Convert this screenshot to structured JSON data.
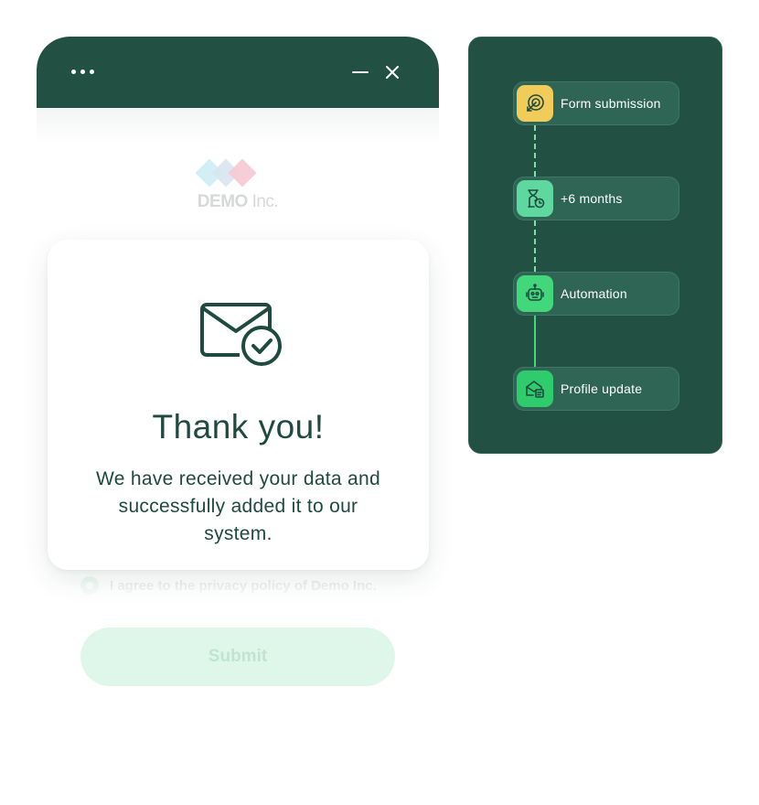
{
  "widget": {
    "logo": {
      "brand": "DEMO",
      "suffix": "Inc."
    },
    "consent_label": "I agree to the privacy policy of Demo Inc.",
    "submit_label": "Submit"
  },
  "card": {
    "title": "Thank you!",
    "message": "We have received your data and successfully added it to our system."
  },
  "workflow": {
    "steps": [
      {
        "label": "Form submission",
        "icon": "form-submission-icon",
        "color": "#f2cc5a"
      },
      {
        "label": "+6 months",
        "icon": "hourglass-timer-icon",
        "color": "#5fd8a0"
      },
      {
        "label": "Automation",
        "icon": "robot-icon",
        "color": "#43d77b"
      },
      {
        "label": "Profile update",
        "icon": "profile-update-icon",
        "color": "#2ecc6c"
      }
    ]
  },
  "colors": {
    "primary_dark": "#225143",
    "accent_green": "#43d77b",
    "accent_yellow": "#f2cc5a"
  }
}
